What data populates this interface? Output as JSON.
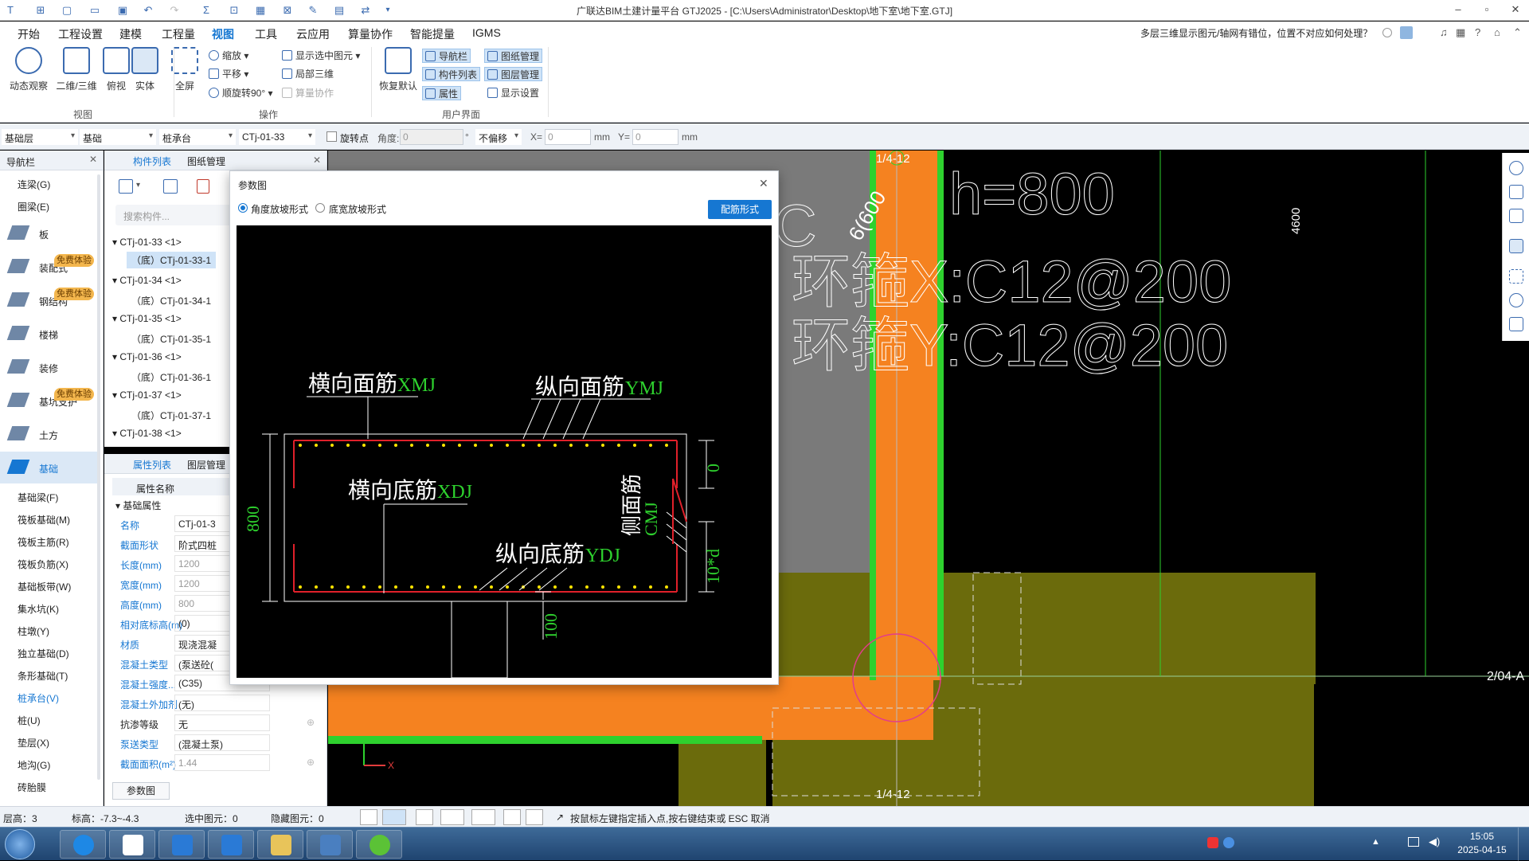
{
  "window": {
    "title": "广联达BIM土建计量平台 GTJ2025 - [C:\\Users\\Administrator\\Desktop\\地下室\\地下室.GTJ]",
    "minimize": "–",
    "restore": "▫",
    "close": "✕"
  },
  "menu": {
    "items": [
      "开始",
      "工程设置",
      "建模",
      "工程量",
      "视图",
      "工具",
      "云应用",
      "算量协作",
      "智能提量",
      "IGMS"
    ],
    "active": "视图",
    "help_question": "多层三维显示图元/轴网有错位，位置不对应如何处理？"
  },
  "ribbon": {
    "view_group": {
      "label": "视图",
      "buttons": [
        "动态观察",
        "二维/三维",
        "俯视",
        "实体"
      ]
    },
    "operate_group": {
      "label": "操作",
      "fullscreen": "全屏",
      "zoom": "缩放",
      "pan": "平移",
      "rotate": "顺旋转90°",
      "show_selected": "显示选中图元",
      "local_3d": "局部三维",
      "collab": "算量协作"
    },
    "ui_group": {
      "label": "用户界面",
      "restore_default": "恢复默认",
      "nav": "导航栏",
      "comp_list": "构件列表",
      "property": "属性",
      "drawing_mgr": "图纸管理",
      "layer_mgr": "图层管理",
      "display_settings": "显示设置"
    }
  },
  "toolbar": {
    "floor": "基础层",
    "category": "基础",
    "type": "桩承台",
    "component": "CTj-01-33",
    "rotate_point": "旋转点",
    "angle_label": "角度:",
    "angle_value": "0",
    "degree": "°",
    "offset": "不偏移",
    "x_label": "X=",
    "x_value": "0",
    "y_label": "Y=",
    "y_value": "0",
    "unit": "mm"
  },
  "nav_panel": {
    "title": "导航栏",
    "top_items": [
      "连梁(G)",
      "圈梁(E)"
    ],
    "categories": [
      {
        "label": "板",
        "badge": ""
      },
      {
        "label": "装配式",
        "badge": "免费体验"
      },
      {
        "label": "钢结构",
        "badge": "免费体验"
      },
      {
        "label": "楼梯",
        "badge": ""
      },
      {
        "label": "装修",
        "badge": ""
      },
      {
        "label": "基坑支护",
        "badge": "免费体验"
      },
      {
        "label": "土方",
        "badge": ""
      },
      {
        "label": "基础",
        "badge": ""
      }
    ],
    "sub_items": [
      "基础梁(F)",
      "筏板基础(M)",
      "筏板主筋(R)",
      "筏板负筋(X)",
      "基础板带(W)",
      "集水坑(K)",
      "柱墩(Y)",
      "独立基础(D)",
      "条形基础(T)",
      "桩承台(V)",
      "桩(U)",
      "垫层(X)",
      "地沟(G)",
      "砖胎膜"
    ],
    "active_sub": "桩承台(V)"
  },
  "comp_panel": {
    "tab_active": "构件列表",
    "tab_other": "图纸管理",
    "search_placeholder": "搜索构件...",
    "tree": [
      {
        "text": "CTj-01-33 <1>",
        "level": 0
      },
      {
        "text": "（底）CTj-01-33-1",
        "level": 1,
        "selected": true
      },
      {
        "text": "CTj-01-34 <1>",
        "level": 0
      },
      {
        "text": "（底）CTj-01-34-1",
        "level": 1
      },
      {
        "text": "CTj-01-35 <1>",
        "level": 0
      },
      {
        "text": "（底）CTj-01-35-1",
        "level": 1
      },
      {
        "text": "CTj-01-36 <1>",
        "level": 0
      },
      {
        "text": "（底）CTj-01-36-1",
        "level": 1
      },
      {
        "text": "CTj-01-37 <1>",
        "level": 0
      },
      {
        "text": "（底）CTj-01-37-1",
        "level": 1
      },
      {
        "text": "CTj-01-38 <1>",
        "level": 0
      }
    ]
  },
  "prop_panel": {
    "tab_active": "属性列表",
    "tab_other": "图层管理",
    "header_name": "属性名称",
    "section": "基础属性",
    "rows": [
      {
        "k": "名称",
        "v": "CTj-01-3",
        "blue": true,
        "gray": false
      },
      {
        "k": "截面形状",
        "v": "阶式四桩",
        "blue": true,
        "gray": false
      },
      {
        "k": "长度(mm)",
        "v": "1200",
        "blue": true,
        "gray": true
      },
      {
        "k": "宽度(mm)",
        "v": "1200",
        "blue": true,
        "gray": true
      },
      {
        "k": "高度(mm)",
        "v": "800",
        "blue": true,
        "gray": true
      },
      {
        "k": "相对底标高(m)",
        "v": "(0)",
        "blue": true,
        "gray": false
      },
      {
        "k": "材质",
        "v": "现浇混凝",
        "blue": true,
        "gray": false
      },
      {
        "k": "混凝土类型",
        "v": "(泵送砼(",
        "blue": true,
        "gray": false
      },
      {
        "k": "混凝土强度...",
        "v": "(C35)",
        "blue": true,
        "gray": false
      },
      {
        "k": "混凝土外加剂",
        "v": "(无)",
        "blue": true,
        "gray": false
      },
      {
        "k": "抗渗等级",
        "v": "无",
        "blue": false,
        "gray": false
      },
      {
        "k": "泵送类型",
        "v": "(混凝土泵)",
        "blue": true,
        "gray": false
      },
      {
        "k": "截面面积(m²)",
        "v": "1.44",
        "blue": true,
        "gray": true
      }
    ],
    "param_button": "参数图"
  },
  "dialog": {
    "title": "参数图",
    "close": "✕",
    "radio1": "角度放坡形式",
    "radio2": "底宽放坡形式",
    "button": "配筋形式",
    "labels": {
      "top_x": "横向面筋",
      "top_x_code": "XMJ",
      "top_y": "纵向面筋",
      "top_y_code": "YMJ",
      "bot_x": "横向底筋",
      "bot_x_code": "XDJ",
      "bot_y": "纵向底筋",
      "bot_y_code": "YDJ",
      "side": "侧面筋",
      "side_code": "CMJ",
      "height": "800",
      "zero": "0",
      "ten_d": "10*d",
      "hundred": "100"
    }
  },
  "canvas": {
    "text_h": "h=800",
    "text_hoop_x": "环箍X:C12@200",
    "text_hoop_y": "环箍Y:C12@200",
    "text_c": "C",
    "text_dims": "6(600",
    "axis_top": "1/4-12",
    "axis_bottom": "1/4-12",
    "axis_right": "2/04-A",
    "dim_4600": "4600",
    "axis_x": "X"
  },
  "status": {
    "floor_height": "层高：3",
    "elevation": "标高：-7.3~-4.3",
    "selected": "选中图元：0",
    "hidden": "隐藏图元：0",
    "hint": "按鼠标左键指定插入点,按右键结束或 ESC 取消"
  },
  "taskbar": {
    "time": "15:05",
    "date": "2025-04-15"
  },
  "colors": {
    "orange": "#f58220",
    "green": "#2ed12e",
    "olive": "#6b6b0c",
    "accent": "#1677d2",
    "rebar_red": "#e0202a",
    "rebar_yellow": "#ffe400"
  }
}
